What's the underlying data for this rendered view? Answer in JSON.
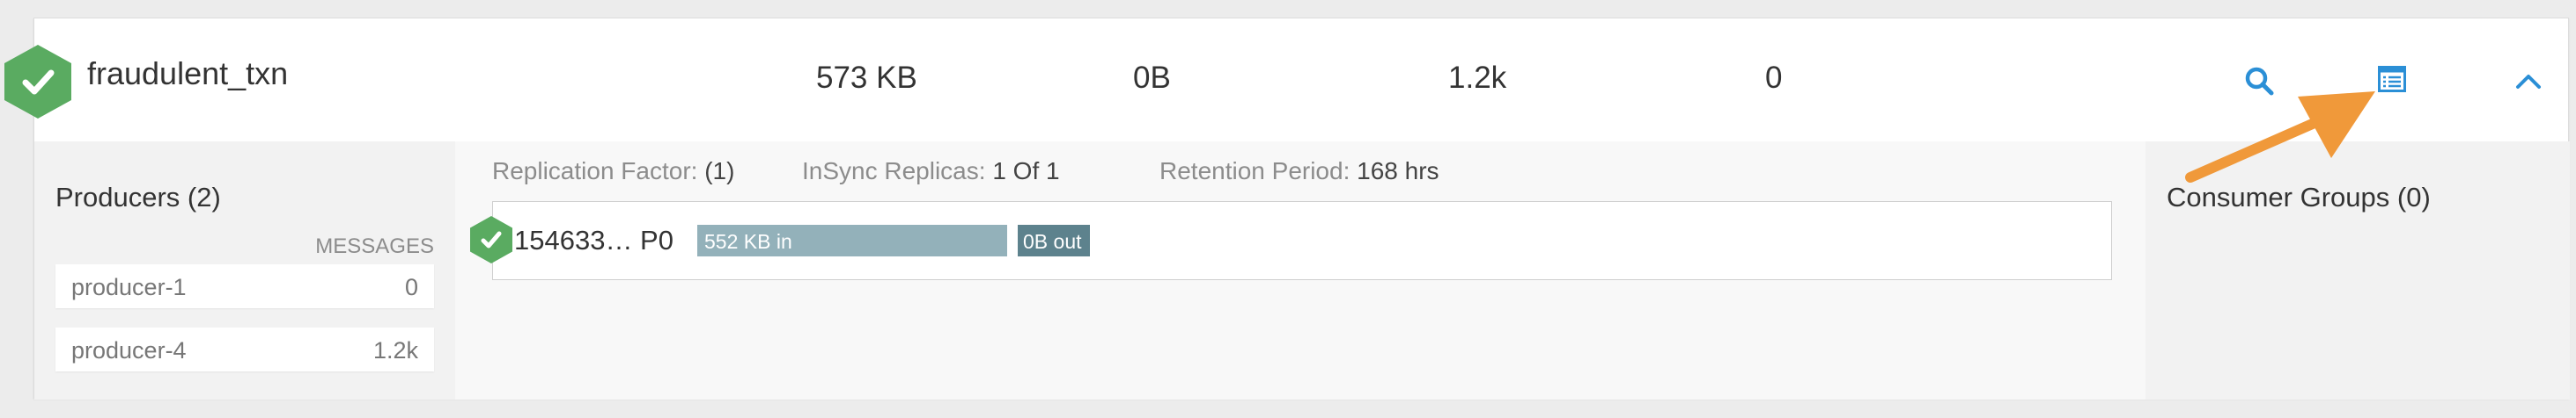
{
  "topic": {
    "name": "fraudulent_txn",
    "status": "healthy",
    "size": "573 KB",
    "bytes": "0B",
    "messages": "1.2k",
    "count": "0"
  },
  "icons": {
    "status": "check-hexagon-icon",
    "search": "search-icon",
    "details": "list-icon",
    "collapse": "chevron-up-icon"
  },
  "colors": {
    "success": "#5aab61",
    "accent": "#2b8fd6",
    "arrow": "#f0993a",
    "bar_in": "#93b1ba",
    "bar_out": "#5d828d"
  },
  "producers": {
    "title": "Producers (2)",
    "column_header": "MESSAGES",
    "items": [
      {
        "name": "producer-1",
        "messages": "0"
      },
      {
        "name": "producer-4",
        "messages": "1.2k"
      }
    ]
  },
  "meta": {
    "replication_label": "Replication Factor:",
    "replication_value": "(1)",
    "insync_label": "InSync Replicas:",
    "insync_value": "1 Of 1",
    "retention_label": "Retention Period:",
    "retention_value": "168 hrs"
  },
  "partition": {
    "label": "154633… P0",
    "in_label": "552 KB in",
    "out_label": "0B out"
  },
  "consumers": {
    "title": "Consumer Groups (0)"
  }
}
